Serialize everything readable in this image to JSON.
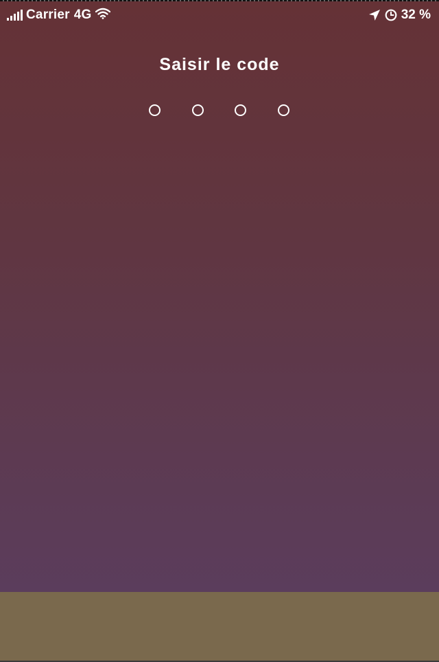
{
  "status_bar": {
    "carrier": "Carrier",
    "network": "4G",
    "battery": "32 %",
    "icons": [
      "signal-icon",
      "wifi-icon",
      "location-arrow-icon",
      "alarm-clock-icon"
    ]
  },
  "passcode": {
    "title": "Saisir le code",
    "digits_entered": 0,
    "digits_total": 4
  },
  "colors": {
    "background_top": "#653236",
    "background_bottom": "#5b3d5c",
    "keypad_area": "#7a694d",
    "text": "#ffffff"
  }
}
